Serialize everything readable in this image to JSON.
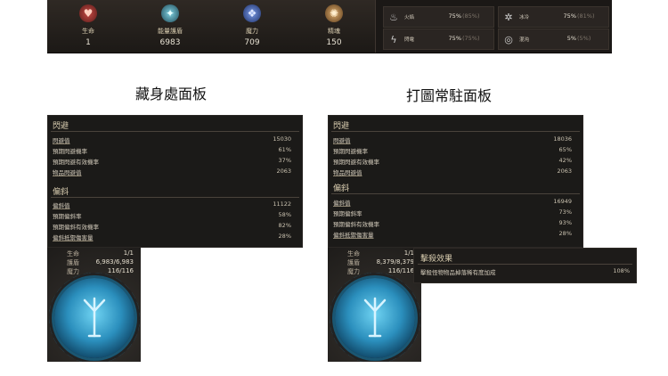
{
  "topbar": {
    "stats": [
      {
        "label": "生命",
        "value": "1",
        "icon": "heart-icon",
        "color": "#c64a44"
      },
      {
        "label": "能量護盾",
        "value": "6983",
        "icon": "energy-shield-icon",
        "color": "#6fb5c9"
      },
      {
        "label": "魔力",
        "value": "709",
        "icon": "mana-icon",
        "color": "#5b7fd6"
      },
      {
        "label": "精魂",
        "value": "150",
        "icon": "spirit-icon",
        "color": "#c89a5b"
      }
    ],
    "resists": [
      {
        "name": "火焰",
        "pct": "75%",
        "max": "(85%)",
        "icon": "fire-icon"
      },
      {
        "name": "冰冷",
        "pct": "75%",
        "max": "(81%)",
        "icon": "cold-icon"
      },
      {
        "name": "閃電",
        "pct": "75%",
        "max": "(75%)",
        "icon": "lightning-icon"
      },
      {
        "name": "混沌",
        "pct": "5%",
        "max": "(5%)",
        "icon": "chaos-icon"
      }
    ]
  },
  "left": {
    "heading": "藏身處面板",
    "evasion": {
      "title": "閃避",
      "rows": [
        {
          "k": "閃避值",
          "v": "15030"
        },
        {
          "k": "預期閃避機率",
          "v": "61%"
        },
        {
          "k": "預期閃避有效機率",
          "v": "37%"
        },
        {
          "k": "物品閃避值",
          "v": "2063"
        }
      ]
    },
    "deflect": {
      "title": "偏斜",
      "rows": [
        {
          "k": "偏斜值",
          "v": "11122"
        },
        {
          "k": "預期偏斜率",
          "v": "58%"
        },
        {
          "k": "預期偏斜有效機率",
          "v": "82%"
        },
        {
          "k": "偏斜抵禦傷害量",
          "v": "28%"
        }
      ]
    },
    "orb": {
      "lines": [
        {
          "k": "生命",
          "v": "1/1"
        },
        {
          "k": "護盾",
          "v": "6,983/6,983"
        },
        {
          "k": "魔力",
          "v": "116/116"
        }
      ]
    }
  },
  "right": {
    "heading": "打圖常駐面板",
    "evasion": {
      "title": "閃避",
      "rows": [
        {
          "k": "閃避值",
          "v": "18036"
        },
        {
          "k": "預期閃避機率",
          "v": "65%"
        },
        {
          "k": "預期閃避有效機率",
          "v": "42%"
        },
        {
          "k": "物品閃避值",
          "v": "2063"
        }
      ]
    },
    "deflect": {
      "title": "偏斜",
      "rows": [
        {
          "k": "偏斜值",
          "v": "16949"
        },
        {
          "k": "預期偏斜率",
          "v": "73%"
        },
        {
          "k": "預期偏斜有效機率",
          "v": "93%"
        },
        {
          "k": "偏斜抵禦傷害量",
          "v": "28%"
        }
      ]
    },
    "orb": {
      "lines": [
        {
          "k": "生命",
          "v": "1/1"
        },
        {
          "k": "護盾",
          "v": "8,379/8,379"
        },
        {
          "k": "魔力",
          "v": "116/116"
        }
      ]
    },
    "kill": {
      "title": "擊殺效果",
      "row": {
        "k": "擊殺怪物物品掉落稀有度加成",
        "v": "108%"
      }
    }
  }
}
